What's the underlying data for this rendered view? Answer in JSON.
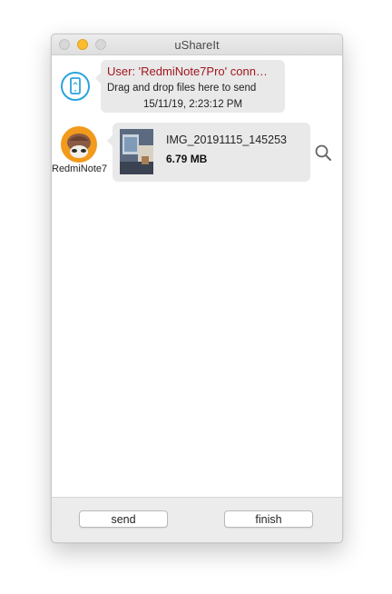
{
  "window": {
    "title": "uShareIt"
  },
  "messages": {
    "connection": {
      "title": "User: 'RedmiNote7Pro' conn…",
      "line": "Drag and drop files here to send",
      "time": "15/11/19, 2:23:12 PM"
    },
    "file": {
      "sender": "RedmiNote7",
      "name": "IMG_20191115_145253",
      "size": "6.79 MB"
    }
  },
  "footer": {
    "send_label": "send",
    "finish_label": "finish"
  },
  "colors": {
    "accent_red": "#a0171e",
    "phone_icon": "#2aa3e0",
    "avatar_bg": "#f19a1c"
  }
}
